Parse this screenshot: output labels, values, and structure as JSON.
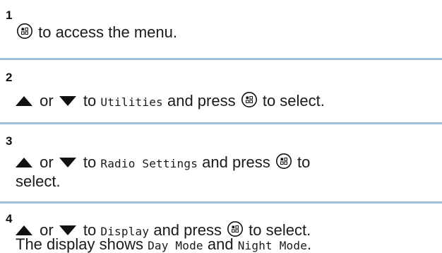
{
  "steps": [
    {
      "number": "1",
      "text_after_icon": " to access the menu."
    },
    {
      "number": "2",
      "or": " or ",
      "to": " to ",
      "target": "Utilities",
      "and_press": " and press ",
      "to_select": " to select."
    },
    {
      "number": "3",
      "or": " or ",
      "to": " to ",
      "target": "Radio Settings",
      "and_press": " and press ",
      "to_tail": " to",
      "select": "select."
    },
    {
      "number": "4",
      "or": " or ",
      "to": " to ",
      "target": "Display",
      "and_press": " and press ",
      "to_select": " to select.",
      "shows_prefix": "The display shows ",
      "mode_day": "Day Mode",
      "and": " and ",
      "mode_night": "Night Mode",
      "period": "."
    }
  ],
  "colors": {
    "separator": "#9fc0dc",
    "text": "#1a1a1a"
  },
  "icons": {
    "menu_ok": "menu-ok-button-icon",
    "up": "up-arrow-icon",
    "down": "down-arrow-icon"
  }
}
